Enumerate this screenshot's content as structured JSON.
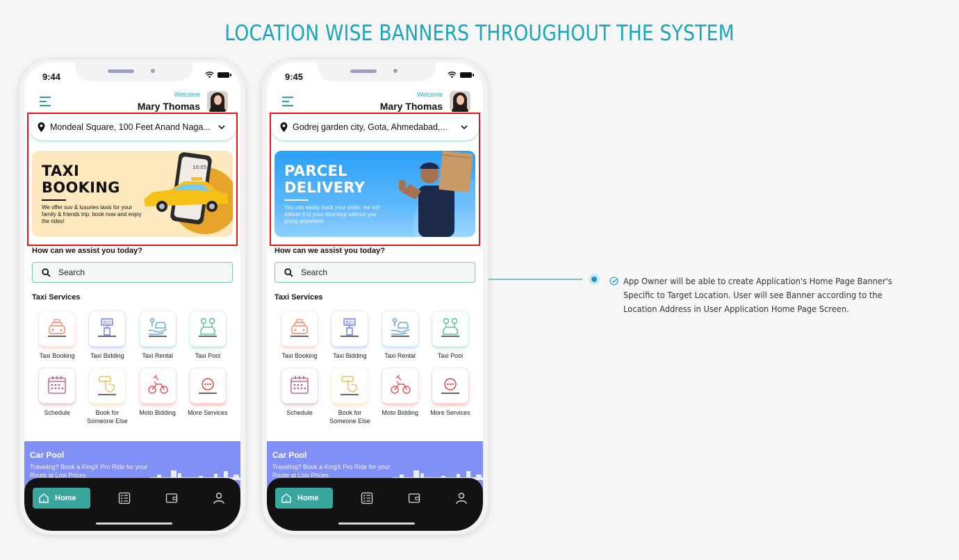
{
  "page": {
    "title": "LOCATION WISE BANNERS THROUGHOUT THE SYSTEM",
    "note": "App Owner will be able to create Application's Home Page Banner's Specific to Target Location. User will see Banner according to the Location Address in User Application Home Page Screen.",
    "accent_color": "#19a7b8"
  },
  "phones": [
    {
      "status_time": "9:44",
      "welcome": "Welcome",
      "user_name": "Mary Thomas",
      "location": "Mondeal Square, 100 Feet Anand Naga...",
      "banner": {
        "title_line1": "TAXI",
        "title_line2": "BOOKING",
        "description": "We offer suv & luxuries taxis for your family & friends trip. book now and enjoy the rides!",
        "phone_clock": "10:05"
      }
    },
    {
      "status_time": "9:45",
      "welcome": "Welcome",
      "user_name": "Mary Thomas",
      "location": "Godrej garden city, Gota, Ahmedabad,...",
      "banner": {
        "title_line1": "PARCEL",
        "title_line2": "DELIVERY",
        "description": "You can easily track your order. we will deliver it to your doorstep without you going anywhere."
      }
    }
  ],
  "home": {
    "assist_label": "How can we assist you today?",
    "search_placeholder": "Search",
    "section_label": "Taxi Services",
    "services": [
      {
        "label": "Taxi Booking",
        "icon": "taxi-icon",
        "color": "#f08a6a"
      },
      {
        "label": "Taxi Bidding",
        "icon": "bid-icon",
        "color": "#6b7bea"
      },
      {
        "label": "Taxi Rental",
        "icon": "rental-icon",
        "color": "#4d9be6"
      },
      {
        "label": "Taxi Pool",
        "icon": "pool-icon",
        "color": "#3fb88a"
      },
      {
        "label": "Schedule",
        "icon": "calendar-icon",
        "color": "#b4527e"
      },
      {
        "label": "Book for Someone Else",
        "icon": "hand-tap-icon",
        "color": "#e9b94a"
      },
      {
        "label": "Moto Bidding",
        "icon": "motorbike-icon",
        "color": "#e6505a"
      },
      {
        "label": "More Services",
        "icon": "more-icon",
        "color": "#e23b3b"
      }
    ],
    "carpool": {
      "title": "Car Pool",
      "description": "Traveling? Book a KingX Pro Ride for your Route at Low Prices."
    },
    "nav": {
      "home_label": "Home",
      "items": [
        "home-icon",
        "orders-list-icon",
        "wallet-icon",
        "profile-icon"
      ]
    }
  }
}
